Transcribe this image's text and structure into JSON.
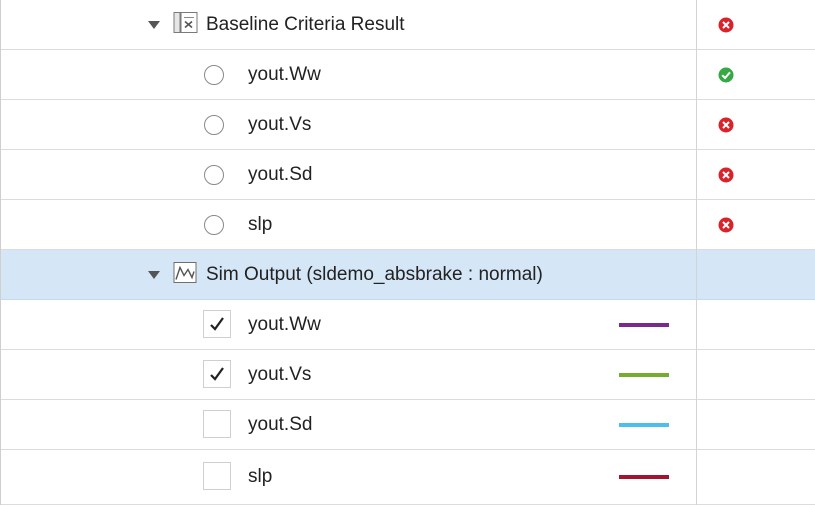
{
  "baseline": {
    "label": "Baseline Criteria Result",
    "icon": "baseline-report-icon",
    "status": "fail",
    "signals": [
      {
        "label": "yout.Ww",
        "status": "pass"
      },
      {
        "label": "yout.Vs",
        "status": "fail"
      },
      {
        "label": "yout.Sd",
        "status": "fail"
      },
      {
        "label": "slp",
        "status": "fail"
      }
    ]
  },
  "sim_output": {
    "label": "Sim Output (sldemo_absbrake : normal)",
    "icon": "signal-wave-icon",
    "signals": [
      {
        "label": "yout.Ww",
        "checked": true,
        "color": "#7b2a8b"
      },
      {
        "label": "yout.Vs",
        "checked": true,
        "color": "#77ac30"
      },
      {
        "label": "yout.Sd",
        "checked": false,
        "color": "#4dbeee"
      },
      {
        "label": "slp",
        "checked": false,
        "color": "#a2142f"
      }
    ]
  },
  "colors": {
    "pass": "#36a844",
    "fail": "#d9232a",
    "selected_row": "#d5e6f6"
  }
}
